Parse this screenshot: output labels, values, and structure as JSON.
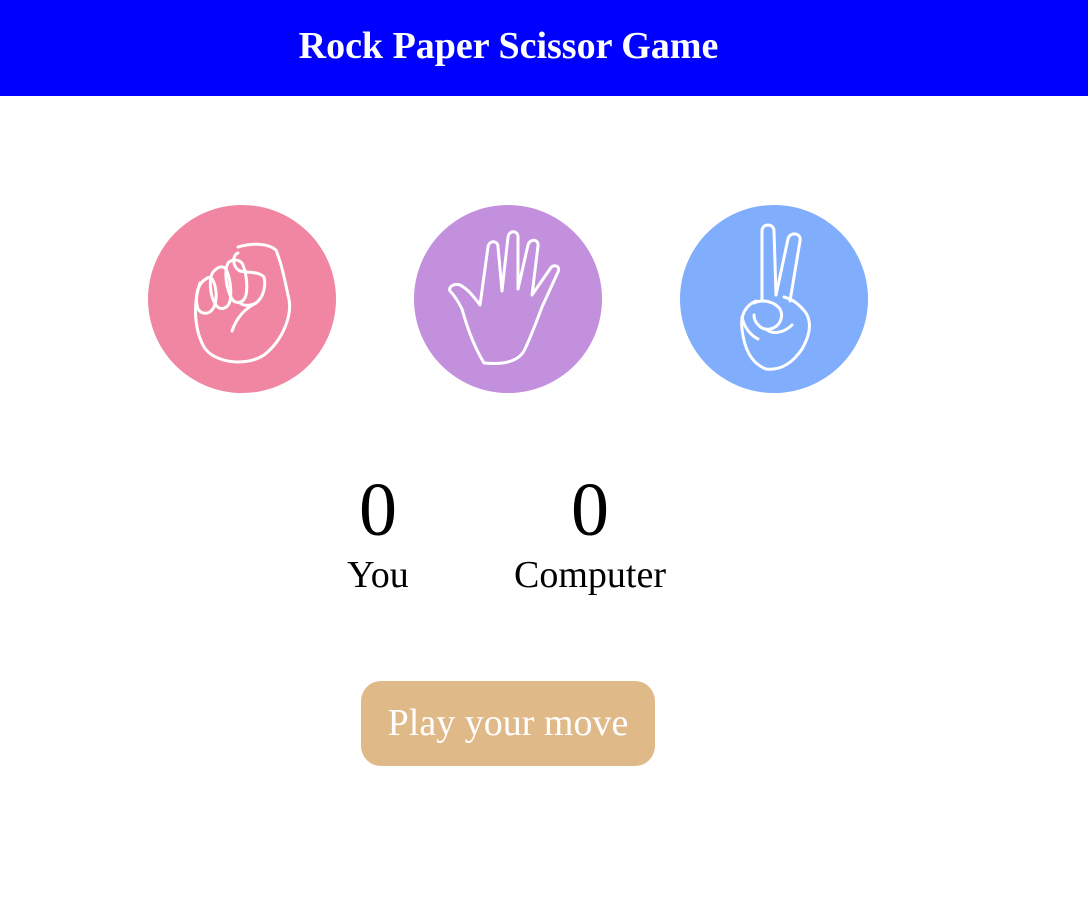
{
  "header": {
    "title": "Rock Paper Scissor Game",
    "background": "#0000ff"
  },
  "choices": [
    {
      "id": "rock",
      "icon": "fist-icon",
      "color": "#f086a2"
    },
    {
      "id": "paper",
      "icon": "open-hand-icon",
      "color": "#c290dd"
    },
    {
      "id": "scissors",
      "icon": "peace-sign-icon",
      "color": "#80adfc"
    }
  ],
  "scoreboard": {
    "you": {
      "score": "0",
      "label": "You"
    },
    "computer": {
      "score": "0",
      "label": "Computer"
    }
  },
  "message": {
    "text": "Play your move",
    "color": "#dfb987"
  }
}
